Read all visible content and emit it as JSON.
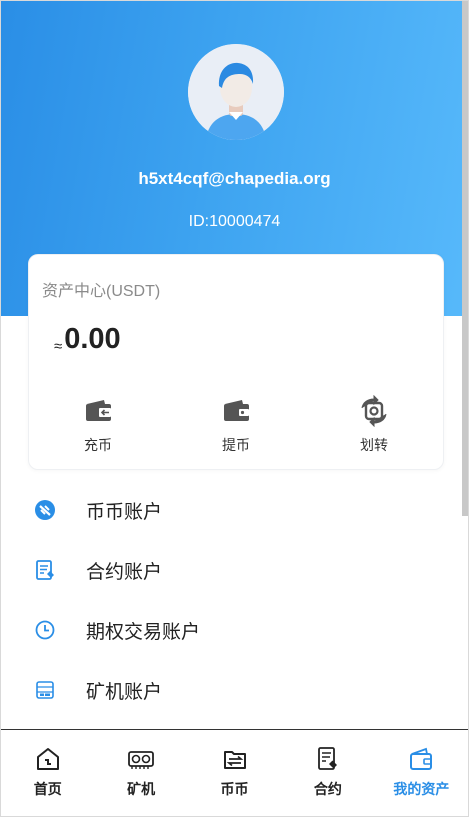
{
  "profile": {
    "email": "h5xt4cqf@chapedia.org",
    "id_text": "ID:10000474"
  },
  "asset_card": {
    "title": "资产中心(USDT)",
    "approx_symbol": "≈",
    "balance": "0.00",
    "actions": [
      {
        "label": "充币",
        "icon": "wallet-in-icon"
      },
      {
        "label": "提币",
        "icon": "wallet-out-icon"
      },
      {
        "label": "划转",
        "icon": "transfer-icon"
      }
    ]
  },
  "menu": [
    {
      "label": "币币账户",
      "icon": "coin-account-icon"
    },
    {
      "label": "合约账户",
      "icon": "contract-account-icon"
    },
    {
      "label": "期权交易账户",
      "icon": "clock-icon"
    },
    {
      "label": "矿机账户",
      "icon": "miner-account-icon"
    }
  ],
  "tabbar": [
    {
      "label": "首页",
      "icon": "home-icon"
    },
    {
      "label": "矿机",
      "icon": "miner-icon"
    },
    {
      "label": "币币",
      "icon": "exchange-icon"
    },
    {
      "label": "合约",
      "icon": "contract-icon"
    },
    {
      "label": "我的资产",
      "icon": "wallet-icon",
      "active": true
    }
  ],
  "colors": {
    "accent": "#2a8ee6",
    "hero_gradient_start": "#2a8ee6",
    "hero_gradient_end": "#57b9fb"
  }
}
